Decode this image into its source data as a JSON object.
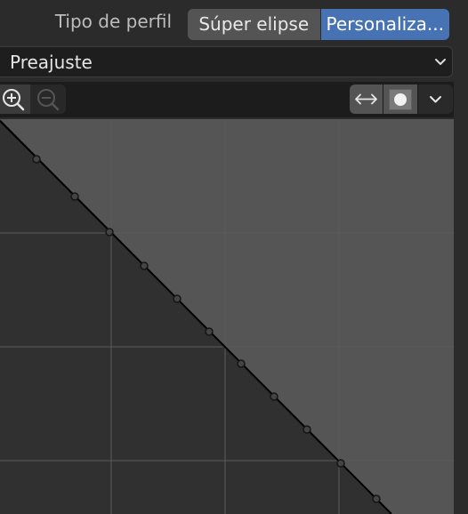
{
  "profile": {
    "label": "Tipo de perfil",
    "options": [
      "Súper elipse",
      "Personaliza..."
    ],
    "selected": "Personaliza..."
  },
  "preset": {
    "label": "Preajuste",
    "icon": "chevron-down-icon"
  },
  "toolbar": {
    "zoom_in_icon": "zoom-in-icon",
    "zoom_out_icon": "zoom-out-icon",
    "zoom_out_enabled": false,
    "clip_icon": "horizontal-arrows-icon",
    "handle_icon": "dot-icon",
    "menu_icon": "chevron-down-icon"
  },
  "colors": {
    "accent": "#4772b3",
    "filled_area": "#555555",
    "empty_area": "#303030",
    "curve": "#000000"
  }
}
